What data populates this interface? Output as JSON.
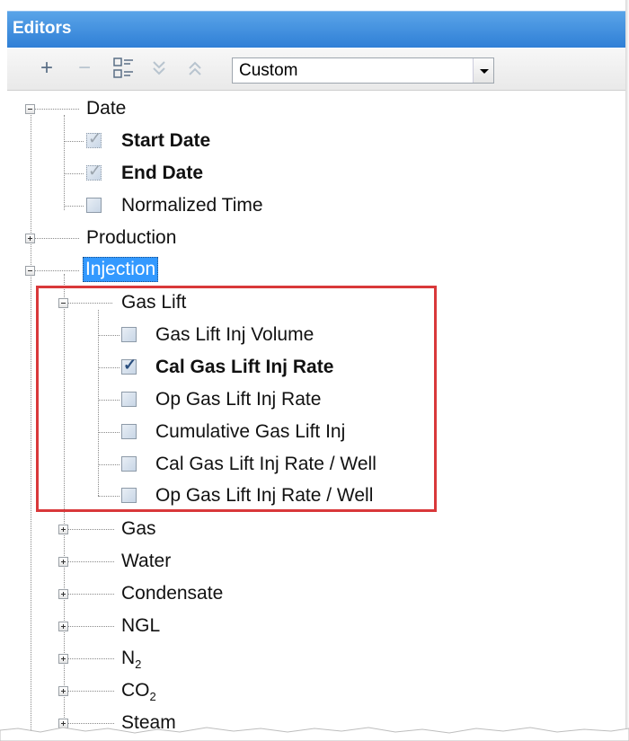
{
  "window": {
    "title": "Editors"
  },
  "toolbar": {
    "add_icon": "plus-icon",
    "remove_icon": "minus-icon",
    "expand_icon": "tree-expand-icon",
    "move_down_icon": "chevron-double-down-icon",
    "move_up_icon": "chevron-double-up-icon",
    "preset_value": "Custom"
  },
  "tree": {
    "date": {
      "label": "Date"
    },
    "start_date": {
      "label": "Start Date",
      "checked": true
    },
    "end_date": {
      "label": "End Date",
      "checked": true
    },
    "normalized_time": {
      "label": "Normalized Time",
      "checked": false
    },
    "production": {
      "label": "Production"
    },
    "injection": {
      "label": "Injection"
    },
    "gas_lift": {
      "label": "Gas Lift"
    },
    "gas_lift_items": [
      {
        "label": "Gas Lift Inj Volume",
        "checked": false
      },
      {
        "label": "Cal Gas Lift Inj Rate",
        "checked": true
      },
      {
        "label": "Op Gas Lift Inj Rate",
        "checked": false
      },
      {
        "label": "Cumulative Gas Lift Inj",
        "checked": false
      },
      {
        "label": "Cal Gas Lift Inj Rate / Well",
        "checked": false
      },
      {
        "label": "Op Gas Lift Inj Rate / Well",
        "checked": false
      }
    ],
    "gas": {
      "label": "Gas"
    },
    "water": {
      "label": "Water"
    },
    "condensate": {
      "label": "Condensate"
    },
    "ngl": {
      "label": "NGL"
    },
    "n2": {
      "label": "N",
      "sub": "2"
    },
    "co2": {
      "label": "CO",
      "sub": "2"
    },
    "steam": {
      "label": "Steam"
    }
  },
  "colors": {
    "title_bar": "#2f7fd6",
    "selection": "#3399ff",
    "highlight_box": "#d9383a"
  }
}
